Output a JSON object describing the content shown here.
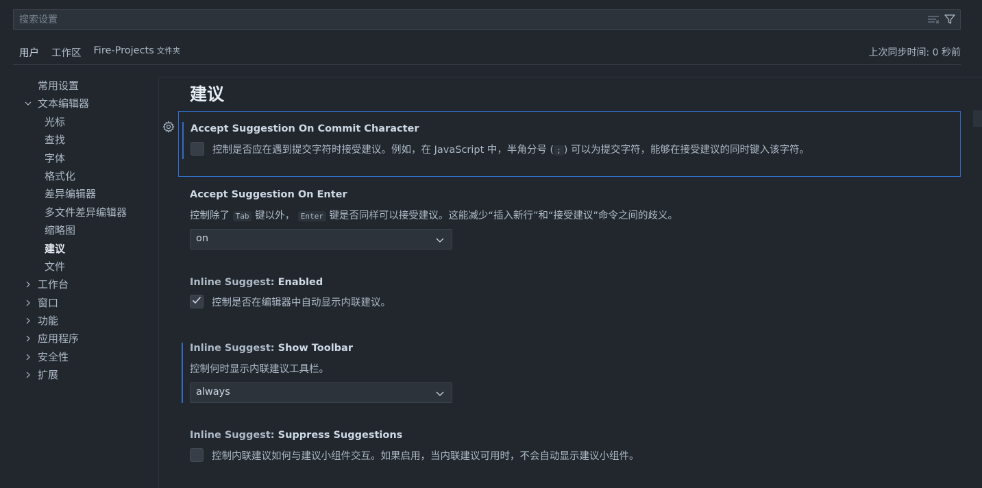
{
  "search": {
    "placeholder": "搜索设置"
  },
  "tabs": [
    {
      "label": "用户",
      "sub": ""
    },
    {
      "label": "工作区",
      "sub": ""
    },
    {
      "label": "Fire-Projects",
      "sub": "文件夹"
    }
  ],
  "sync_status": "上次同步时间: 0 秒前",
  "tree": {
    "common": "常用设置",
    "text_editor": "文本编辑器",
    "children": [
      "光标",
      "查找",
      "字体",
      "格式化",
      "差异编辑器",
      "多文件差异编辑器",
      "缩略图",
      "建议",
      "文件"
    ],
    "sections": [
      "工作台",
      "窗口",
      "功能",
      "应用程序",
      "安全性",
      "扩展"
    ]
  },
  "section_title": "建议",
  "settings": {
    "commit_char": {
      "title": "Accept Suggestion On Commit Character",
      "desc_a": "控制是否应在遇到提交字符时接受建议。例如，在 JavaScript 中，半角分号 (",
      "key": ";",
      "desc_b": ") 可以为提交字符，能够在接受建议的同时键入该字符。",
      "checked": false
    },
    "on_enter": {
      "title": "Accept Suggestion On Enter",
      "desc_a": "控制除了",
      "key1": "Tab",
      "desc_b": "键以外，",
      "key2": "Enter",
      "desc_c": "键是否同样可以接受建议。这能减少“插入新行”和“接受建议”命令之间的歧义。",
      "value": "on"
    },
    "inline_enabled": {
      "category": "Inline Suggest: ",
      "name": "Enabled",
      "desc": "控制是否在编辑器中自动显示内联建议。",
      "checked": true
    },
    "inline_toolbar": {
      "category": "Inline Suggest: ",
      "name": "Show Toolbar",
      "desc": "控制何时显示内联建议工具栏。",
      "value": "always"
    },
    "inline_suppress": {
      "category": "Inline Suggest: ",
      "name": "Suppress Suggestions",
      "desc": "控制内联建议如何与建议小组件交互。如果启用，当内联建议可用时，不会自动显示建议小组件。",
      "checked": false
    }
  },
  "colors": {
    "accent": "#316dca",
    "background": "#22272e",
    "input_bg": "#2d333b"
  }
}
